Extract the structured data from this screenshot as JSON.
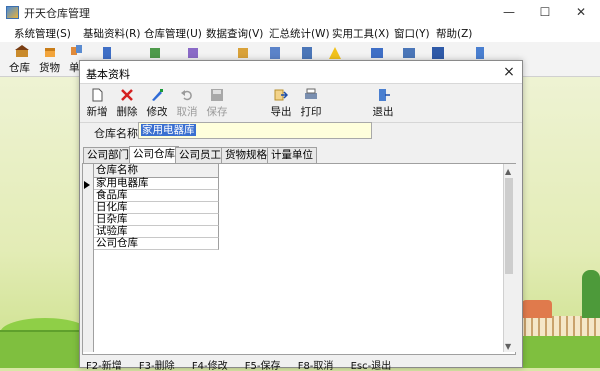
{
  "app": {
    "title": "开天仓库管理",
    "window_controls": [
      "—",
      "☐",
      "✕"
    ]
  },
  "menu": [
    "系统管理(S)",
    "基础资料(R)",
    "仓库管理(U)",
    "数据查询(V)",
    "汇总统计(W)",
    "实用工具(X)",
    "窗口(Y)",
    "帮助(Z)"
  ],
  "main_toolbar": {
    "labels": [
      "仓库",
      "货物",
      "单"
    ]
  },
  "dialog": {
    "title": "基本资料",
    "close": "×",
    "tools": [
      {
        "label": "新增",
        "enabled": true,
        "icon": "new-document-icon"
      },
      {
        "label": "删除",
        "enabled": true,
        "icon": "delete-x-icon"
      },
      {
        "label": "修改",
        "enabled": true,
        "icon": "edit-pen-icon"
      },
      {
        "label": "取消",
        "enabled": false,
        "icon": "undo-icon"
      },
      {
        "label": "保存",
        "enabled": false,
        "icon": "save-disk-icon"
      },
      {
        "label": "导出",
        "enabled": true,
        "icon": "export-icon"
      },
      {
        "label": "打印",
        "enabled": true,
        "icon": "printer-icon"
      },
      {
        "label": "退出",
        "enabled": true,
        "icon": "exit-door-icon"
      }
    ],
    "field": {
      "label": "仓库名称",
      "value": "家用电器库"
    },
    "tabs": [
      "公司部门",
      "公司仓库",
      "公司员工",
      "货物规格",
      "计量单位"
    ],
    "active_tab": 1,
    "grid": {
      "header": "仓库名称",
      "rows": [
        "家用电器库",
        "食品库",
        "日化库",
        "日杂库",
        "试验库",
        "公司仓库"
      ],
      "selected_row": 0
    },
    "status": [
      "F2-新增",
      "F3-删除",
      "F4-修改",
      "F5-保存",
      "F8-取消",
      "Esc-退出"
    ]
  },
  "colors": {
    "selection": "#3a6fd0",
    "input_bg": "#ffffdc"
  }
}
